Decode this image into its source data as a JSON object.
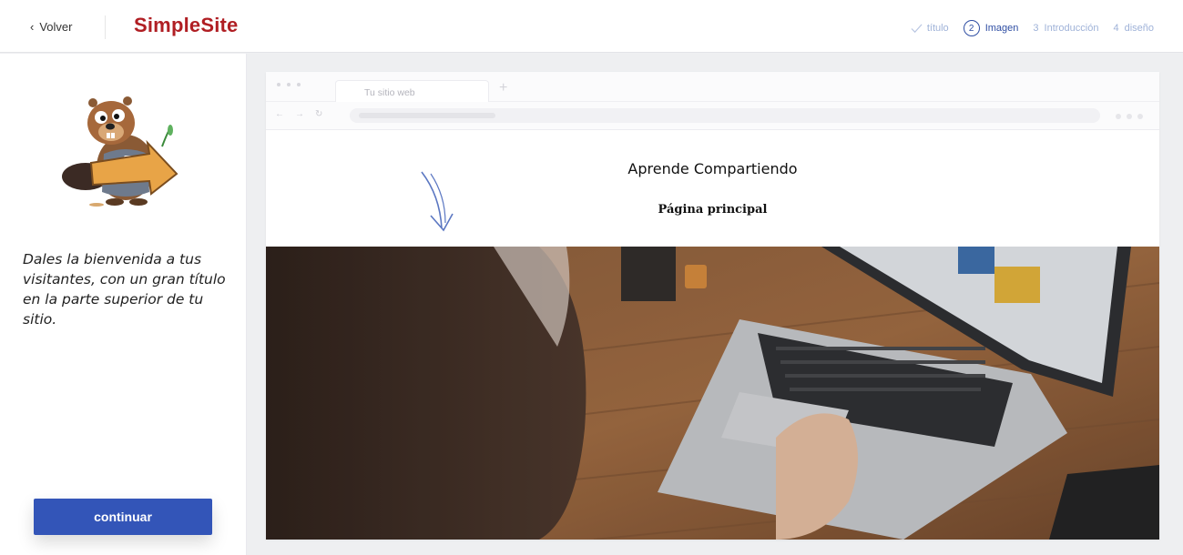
{
  "header": {
    "back_label": "Volver",
    "logo": "SimpleSite",
    "steps": [
      {
        "label": "título",
        "status": "done"
      },
      {
        "num": "2",
        "label": "Imagen",
        "status": "active"
      },
      {
        "num": "3",
        "label": "Introducción",
        "status": "pending"
      },
      {
        "num": "4",
        "label": "diseño",
        "status": "pending"
      }
    ]
  },
  "left_panel": {
    "intro_text": "Dales la bienvenida a tus visitantes, con un gran título en la parte superior de tu sitio.",
    "continue_label": "continuar"
  },
  "preview": {
    "tab_title": "Tu sitio web",
    "site_title": "Aprende Compartiendo",
    "nav_item": "Página principal"
  },
  "colors": {
    "brand_red": "#b01e23",
    "accent_blue": "#3355b8",
    "step_active": "#2f4ea3",
    "step_inactive": "#9fb2d8"
  }
}
